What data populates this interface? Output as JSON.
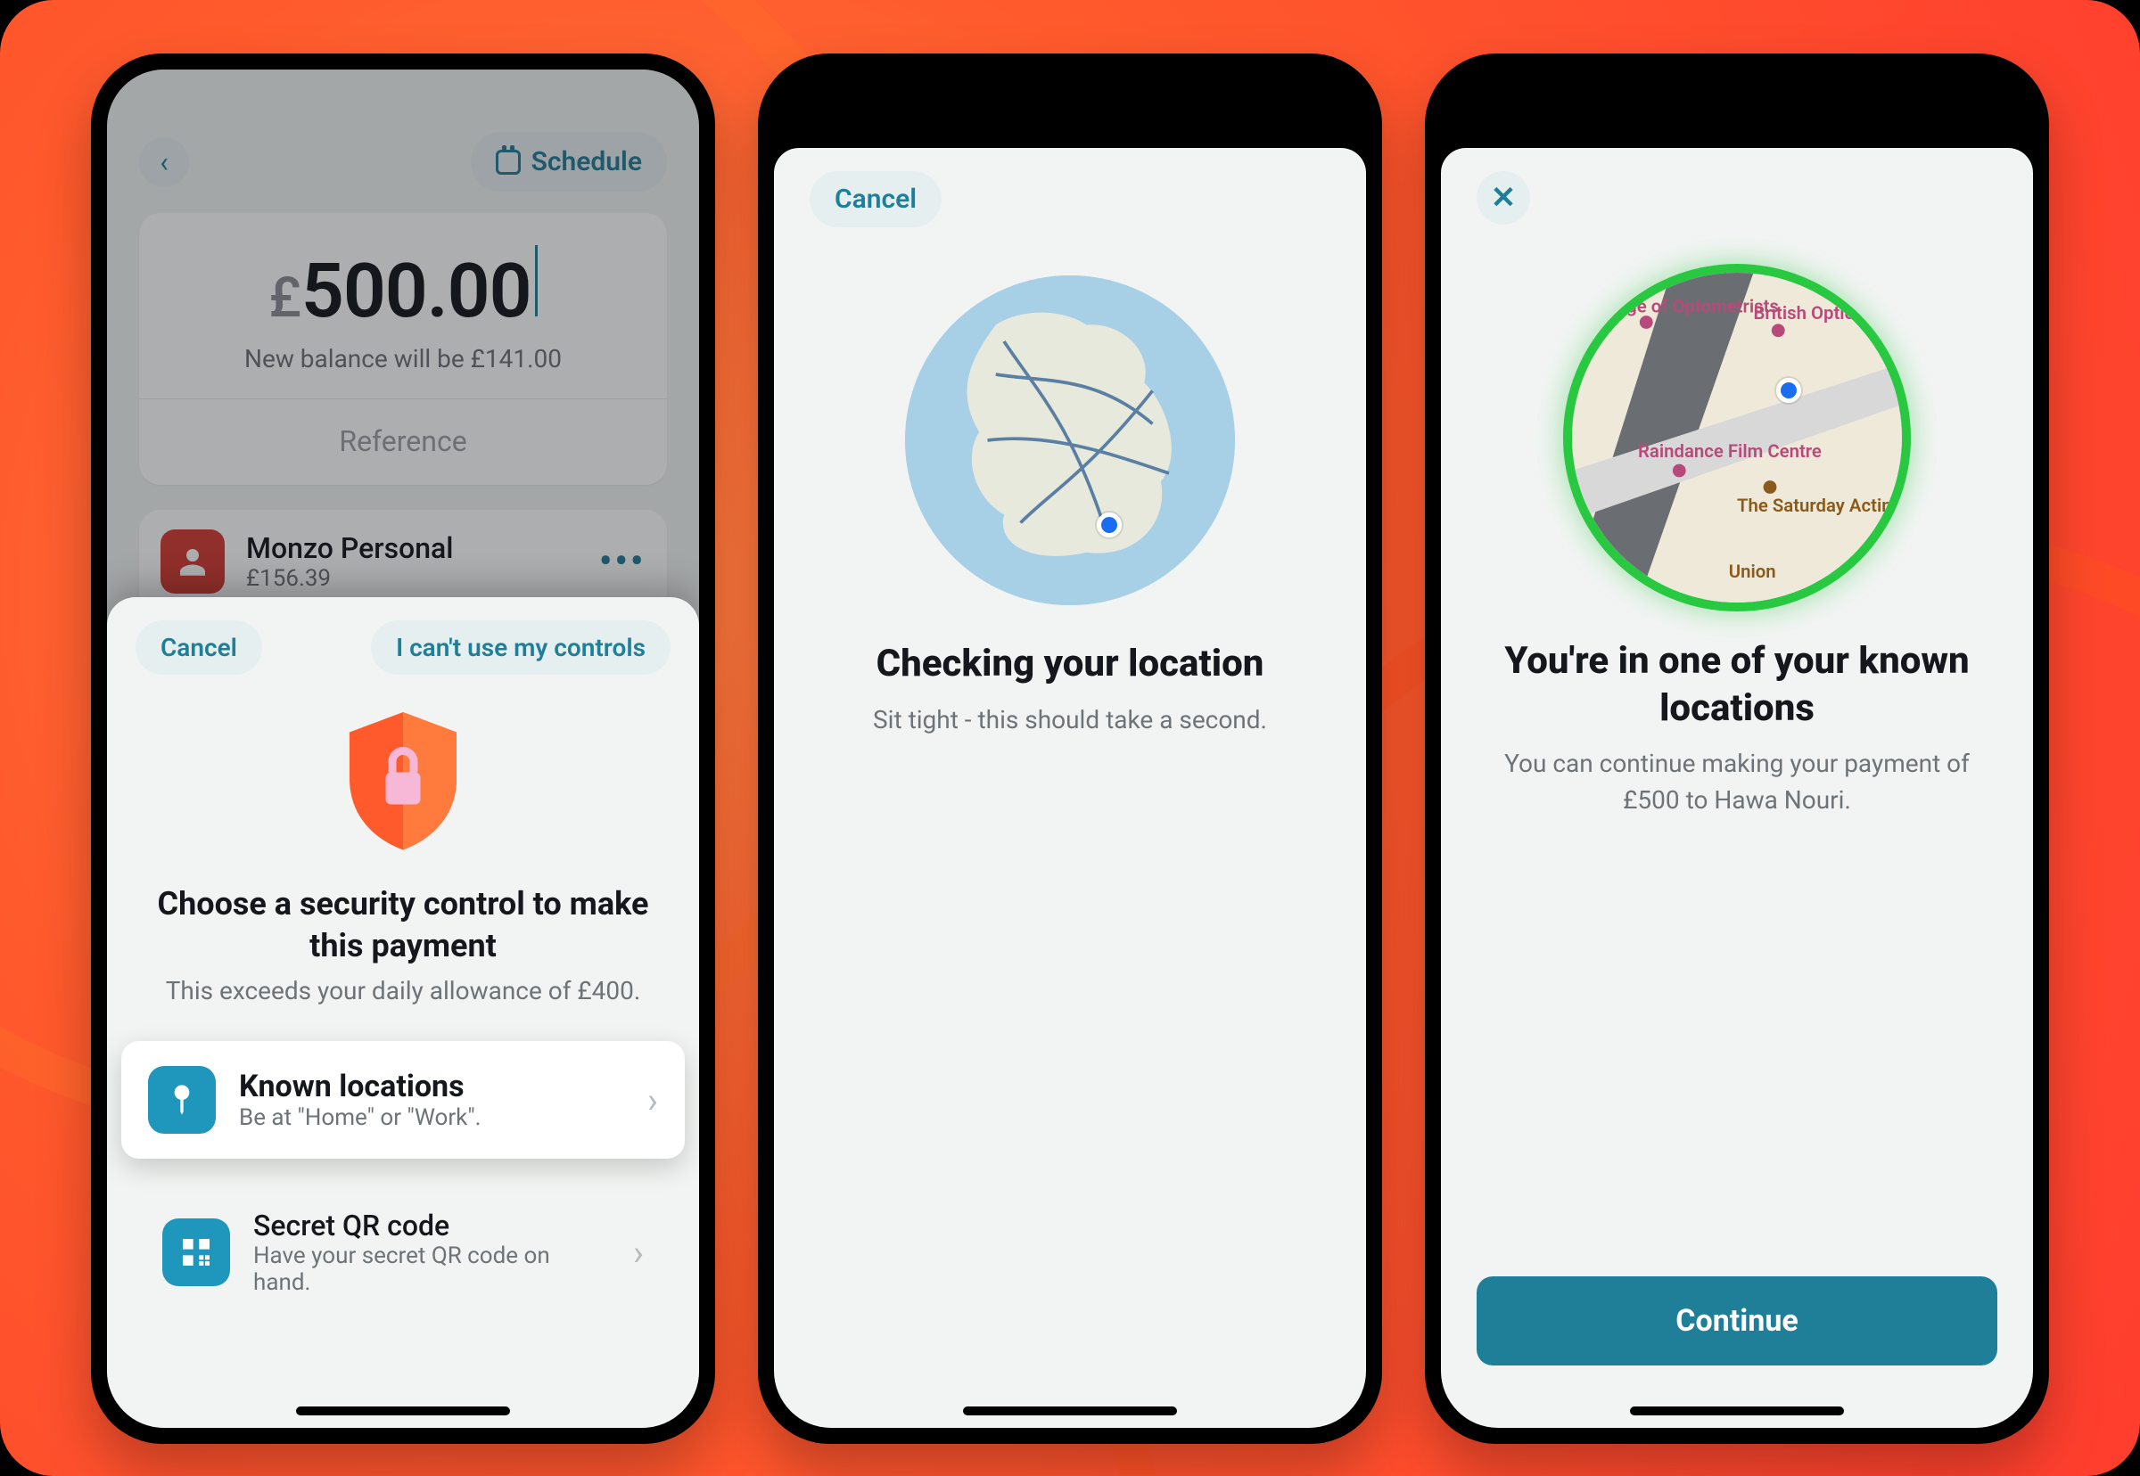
{
  "colors": {
    "accent": "#1f7f99",
    "brand_red": "#ff4d2e",
    "success": "#28c840"
  },
  "phone1": {
    "back_label": "‹",
    "schedule_label": "Schedule",
    "currency_symbol": "£",
    "amount": "500.00",
    "balance_hint": "New balance will be £141.00",
    "reference_placeholder": "Reference",
    "account": {
      "name": "Monzo Personal",
      "balance": "£156.39"
    },
    "sheet": {
      "cancel_label": "Cancel",
      "alt_label": "I can't use my controls",
      "title": "Choose a security control to make this payment",
      "subtitle": "This exceeds your daily allowance of £400.",
      "options": [
        {
          "icon": "pin-icon",
          "title": "Known locations",
          "subtitle": "Be at \"Home\" or \"Work\"."
        },
        {
          "icon": "qr-icon",
          "title": "Secret QR code",
          "subtitle": "Have your secret QR code on hand."
        }
      ]
    }
  },
  "phone2": {
    "cancel_label": "Cancel",
    "title": "Checking your location",
    "subtitle": "Sit tight - this should take a second."
  },
  "phone3": {
    "close_glyph": "✕",
    "title": "You're in one of your known locations",
    "subtitle": "You can continue making your payment of £500 to Hawa Nouri.",
    "continue_label": "Continue",
    "pois": {
      "a": "College of Optometrists",
      "b": "British Optical Association Museum",
      "c": "Raindance Film Centre",
      "d": "The Saturday Acting Academy",
      "e": "Union"
    }
  }
}
